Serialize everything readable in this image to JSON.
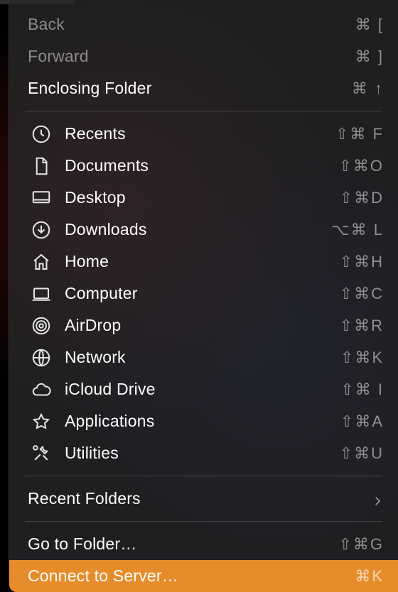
{
  "nav": {
    "back": {
      "label": "Back",
      "shortcut": "⌘ ["
    },
    "forward": {
      "label": "Forward",
      "shortcut": "⌘ ]"
    },
    "enclosing": {
      "label": "Enclosing Folder",
      "shortcut": "⌘ ↑"
    }
  },
  "locations": [
    {
      "key": "recents",
      "label": "Recents",
      "shortcut": "⇧⌘ F"
    },
    {
      "key": "documents",
      "label": "Documents",
      "shortcut": "⇧⌘O"
    },
    {
      "key": "desktop",
      "label": "Desktop",
      "shortcut": "⇧⌘D"
    },
    {
      "key": "downloads",
      "label": "Downloads",
      "shortcut": "⌥⌘ L"
    },
    {
      "key": "home",
      "label": "Home",
      "shortcut": "⇧⌘H"
    },
    {
      "key": "computer",
      "label": "Computer",
      "shortcut": "⇧⌘C"
    },
    {
      "key": "airdrop",
      "label": "AirDrop",
      "shortcut": "⇧⌘R"
    },
    {
      "key": "network",
      "label": "Network",
      "shortcut": "⇧⌘K"
    },
    {
      "key": "icloud",
      "label": "iCloud Drive",
      "shortcut": "⇧⌘ I"
    },
    {
      "key": "applications",
      "label": "Applications",
      "shortcut": "⇧⌘A"
    },
    {
      "key": "utilities",
      "label": "Utilities",
      "shortcut": "⇧⌘U"
    }
  ],
  "recent_folders": {
    "label": "Recent Folders"
  },
  "goto": {
    "label": "Go to Folder…",
    "shortcut": "⇧⌘G"
  },
  "connect": {
    "label": "Connect to Server…",
    "shortcut": "⌘K"
  },
  "style": {
    "highlight": "#e78c2b",
    "text": "#ffffff",
    "muted": "#8a8a8d"
  }
}
